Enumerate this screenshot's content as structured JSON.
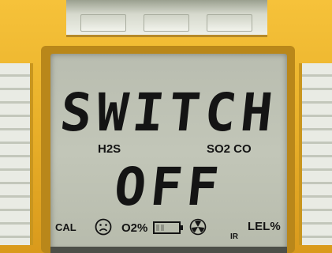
{
  "display": {
    "line1": "SWITCH",
    "line2": "OFF"
  },
  "indicators": {
    "h2s": "H2S",
    "so2co": "SO2 CO",
    "cal": "CAL",
    "o2": "O2%",
    "ir": "IR",
    "lel": "LEL%"
  },
  "icons": {
    "face": "sad-face-icon",
    "battery": "battery-icon",
    "fan": "fan-icon"
  },
  "colors": {
    "housing": "#eab22b",
    "lcd_background": "#c0c4b6",
    "segment": "#141414"
  }
}
